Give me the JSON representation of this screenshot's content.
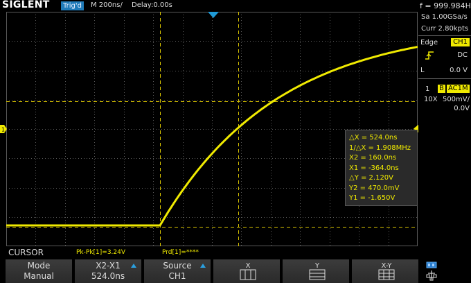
{
  "header": {
    "brand": "SIGLENT",
    "trigger_status": "Trig'd",
    "timebase": "M 200ns/",
    "delay": "Delay:0.00s"
  },
  "right_panel": {
    "frequency": "f = 999.984Hz",
    "sample_rate": "Sa 1.00GSa/s",
    "memory": "Curr 2.80kpts",
    "trigger": {
      "type_label": "Edge",
      "source": "CH1",
      "slope_icon": "rising-edge-icon",
      "coupling": "DC",
      "level_label": "L",
      "level_value": "0.0 V"
    },
    "channel": {
      "number": "1",
      "bw_limit": "B",
      "coupling": "AC1M",
      "probe": "10X",
      "volts_per_div": "500mV/",
      "offset": "0.0V"
    }
  },
  "cursor_readout": {
    "dx": "△X = 524.0ns",
    "inv_dx": "1/△X = 1.908MHz",
    "x2": "X2 = 160.0ns",
    "x1": "X1 = -364.0ns",
    "dy": "△Y = 2.120V",
    "y2": "Y2 = 470.0mV",
    "y1": "Y1 = -1.650V"
  },
  "status": {
    "menu_title": "CURSOR",
    "pk_pk": "Pk-Pk[1]=3.24V",
    "period": "Prd[1]=****"
  },
  "softkeys": {
    "mode_label": "Mode",
    "mode_value": "Manual",
    "pair_label": "X2-X1",
    "pair_value": "524.0ns",
    "source_label": "Source",
    "source_value": "CH1",
    "x_label": "X",
    "y_label": "Y",
    "xy_label": "X-Y"
  },
  "colors": {
    "trace": "#f0ea00",
    "trigger_badge": "#1f7ab8",
    "cursor": "#d9c400",
    "grid": "#5a5a5a"
  }
}
